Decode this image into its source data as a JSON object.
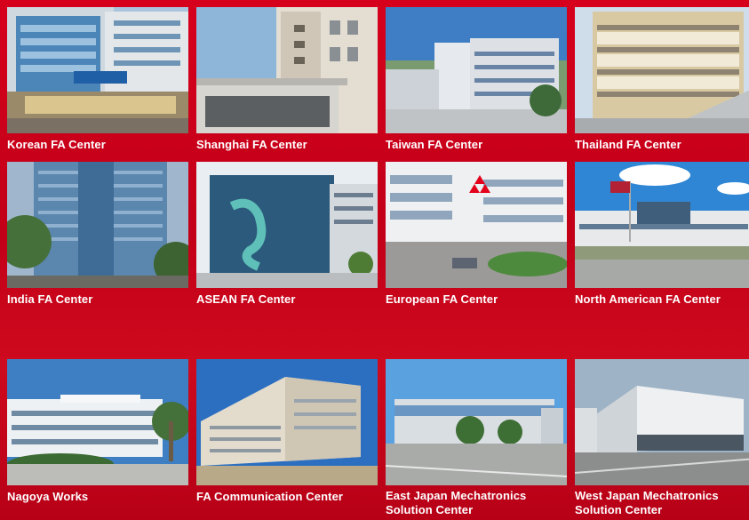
{
  "centers": [
    {
      "label": "Korean FA Center"
    },
    {
      "label": "Shanghai FA Center"
    },
    {
      "label": "Taiwan FA Center"
    },
    {
      "label": "Thailand FA Center"
    },
    {
      "label": "India FA Center"
    },
    {
      "label": "ASEAN FA Center"
    },
    {
      "label": "European FA Center"
    },
    {
      "label": "North American FA Center"
    },
    {
      "label": "Nagoya Works"
    },
    {
      "label": "FA Communication Center"
    },
    {
      "label": "East Japan Mechatronics\nSolution Center"
    },
    {
      "label": "West Japan Mechatronics\nSolution Center"
    }
  ],
  "colors": {
    "background": "#c8001a",
    "label_text": "#ffffff"
  }
}
